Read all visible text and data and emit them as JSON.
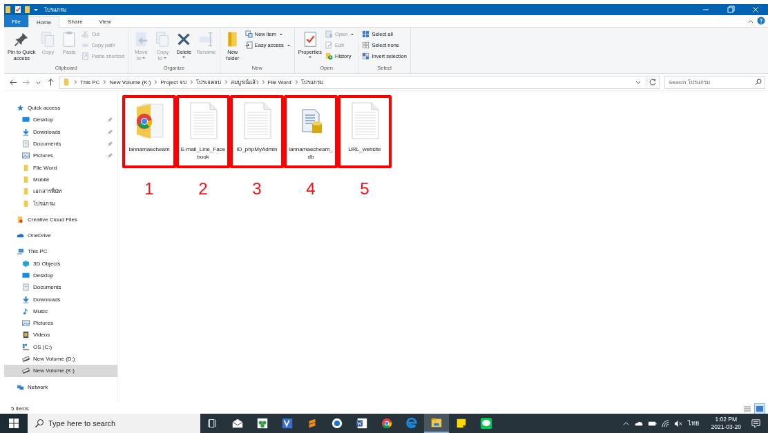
{
  "window": {
    "title": "โปรแกรม"
  },
  "ribbon_tabs": [
    {
      "label": "File",
      "kind": "file",
      "selected": false
    },
    {
      "label": "Home",
      "kind": "tab",
      "selected": true
    },
    {
      "label": "Share",
      "kind": "tab",
      "selected": false
    },
    {
      "label": "View",
      "kind": "tab",
      "selected": false
    }
  ],
  "ribbon_groups": [
    {
      "label": "Clipboard",
      "large": [
        {
          "kind": "pin",
          "lines": [
            "Pin to Quick",
            "access"
          ],
          "disabled": false,
          "dropdown": false
        },
        {
          "kind": "copy",
          "lines": [
            "Copy"
          ],
          "disabled": true,
          "dropdown": false
        },
        {
          "kind": "paste",
          "lines": [
            "Paste"
          ],
          "disabled": true,
          "dropdown": false
        }
      ],
      "small": [
        {
          "kind": "cut",
          "label": "Cut",
          "disabled": true,
          "dropdown": false
        },
        {
          "kind": "copy-path",
          "label": "Copy path",
          "disabled": true,
          "dropdown": false
        },
        {
          "kind": "paste-shortcut",
          "label": "Paste shortcut",
          "disabled": true,
          "dropdown": false
        }
      ]
    },
    {
      "label": "Organize",
      "large": [
        {
          "kind": "move",
          "lines": [
            "Move",
            "to"
          ],
          "disabled": true,
          "dropdown": true
        },
        {
          "kind": "copy-to",
          "lines": [
            "Copy",
            "to"
          ],
          "disabled": true,
          "dropdown": true
        },
        {
          "kind": "delete",
          "lines": [
            "Delete"
          ],
          "disabled": false,
          "dropdown": true
        },
        {
          "kind": "rename",
          "lines": [
            "Rename"
          ],
          "disabled": true,
          "dropdown": false
        }
      ]
    },
    {
      "label": "New",
      "large": [
        {
          "kind": "new-folder",
          "lines": [
            "New",
            "folder"
          ],
          "disabled": false,
          "dropdown": false
        }
      ],
      "small": [
        {
          "kind": "new-item",
          "label": "New item",
          "disabled": false,
          "dropdown": true
        },
        {
          "kind": "easy-access",
          "label": "Easy access",
          "disabled": false,
          "dropdown": true
        }
      ]
    },
    {
      "label": "Open",
      "large": [
        {
          "kind": "properties",
          "lines": [
            "Properties"
          ],
          "disabled": false,
          "dropdown": true
        }
      ],
      "small": [
        {
          "kind": "open",
          "label": "Open",
          "disabled": true,
          "dropdown": true
        },
        {
          "kind": "edit",
          "label": "Edit",
          "disabled": true,
          "dropdown": false
        },
        {
          "kind": "history",
          "label": "History",
          "disabled": false,
          "dropdown": false
        }
      ]
    },
    {
      "label": "Select",
      "small": [
        {
          "kind": "select-all",
          "label": "Select all",
          "disabled": false,
          "dropdown": false
        },
        {
          "kind": "select-none",
          "label": "Select none",
          "disabled": false,
          "dropdown": false
        },
        {
          "kind": "invert",
          "label": "Invert selection",
          "disabled": false,
          "dropdown": false
        }
      ]
    }
  ],
  "nav_buttons": [
    {
      "kind": "back",
      "disabled": false
    },
    {
      "kind": "forward",
      "disabled": true
    },
    {
      "kind": "recent",
      "disabled": false
    },
    {
      "kind": "up",
      "disabled": false
    }
  ],
  "breadcrumbs": [
    "This PC",
    "New Volume (K:)",
    "Project จบ",
    "โปรเจคจบ",
    "สมบูรณ์แล้ว",
    "File Word",
    "โปรแกรม"
  ],
  "search": {
    "placeholder": "Search โปรแกรม"
  },
  "sidebar": [
    {
      "label": "Quick access",
      "kind": "star",
      "selected": false,
      "children": [
        {
          "label": "Desktop",
          "kind": "desktop",
          "selected": false,
          "pinned": true
        },
        {
          "label": "Downloads",
          "kind": "download",
          "selected": false,
          "pinned": true
        },
        {
          "label": "Documents",
          "kind": "document",
          "selected": false,
          "pinned": true
        },
        {
          "label": "Pictures",
          "kind": "pictures",
          "selected": false,
          "pinned": true
        },
        {
          "label": "File Word",
          "kind": "folder",
          "selected": false,
          "pinned": false
        },
        {
          "label": "Mobile",
          "kind": "folder",
          "selected": false,
          "pinned": false
        },
        {
          "label": "เอกสารพี่นัท",
          "kind": "folder",
          "selected": false,
          "pinned": false
        },
        {
          "label": "โปรแกรม",
          "kind": "folder",
          "selected": false,
          "pinned": false
        }
      ]
    },
    {
      "label": "Creative Cloud Files",
      "kind": "cloud-folder",
      "selected": false
    },
    {
      "label": "OneDrive",
      "kind": "cloud",
      "selected": false
    },
    {
      "label": "This PC",
      "kind": "pc",
      "selected": false,
      "children": [
        {
          "label": "3D Objects",
          "kind": "cube",
          "selected": false,
          "pinned": false
        },
        {
          "label": "Desktop",
          "kind": "desktop",
          "selected": false,
          "pinned": false
        },
        {
          "label": "Documents",
          "kind": "document",
          "selected": false,
          "pinned": false
        },
        {
          "label": "Downloads",
          "kind": "download",
          "selected": false,
          "pinned": false
        },
        {
          "label": "Music",
          "kind": "music",
          "selected": false,
          "pinned": false
        },
        {
          "label": "Pictures",
          "kind": "pictures",
          "selected": false,
          "pinned": false
        },
        {
          "label": "Videos",
          "kind": "video",
          "selected": false,
          "pinned": false
        },
        {
          "label": "OS (C:)",
          "kind": "os-drive",
          "selected": false,
          "pinned": false
        },
        {
          "label": "New Volume (D:)",
          "kind": "drive",
          "selected": false,
          "pinned": false
        },
        {
          "label": "New Volume (K:)",
          "kind": "drive",
          "selected": true,
          "pinned": false
        }
      ]
    },
    {
      "label": "Network",
      "kind": "network",
      "selected": false
    }
  ],
  "files": [
    {
      "kind": "chrome-folder",
      "name_lines": [
        "lannamaecheam"
      ],
      "marker": "1",
      "annotated": true
    },
    {
      "kind": "text",
      "name_lines": [
        "E-mail_Line_Face",
        "book"
      ],
      "marker": "2",
      "annotated": true
    },
    {
      "kind": "text",
      "name_lines": [
        "ID_phpMyAdmin"
      ],
      "marker": "3",
      "annotated": true
    },
    {
      "kind": "database",
      "name_lines": [
        "lannamaecheam_",
        "db"
      ],
      "marker": "4",
      "annotated": true
    },
    {
      "kind": "text",
      "name_lines": [
        "URL_website"
      ],
      "marker": "5",
      "annotated": true
    }
  ],
  "status_bar": {
    "item_count": "5 items",
    "views": [
      {
        "kind": "details",
        "selected": false
      },
      {
        "kind": "large-icons",
        "selected": true
      }
    ]
  },
  "taskbar": {
    "search_placeholder": "Type here to search",
    "apps": [
      {
        "kind": "task-view",
        "active": false
      },
      {
        "kind": "mail",
        "active": false
      },
      {
        "kind": "green-app",
        "active": false
      },
      {
        "kind": "blue-app",
        "active": false
      },
      {
        "kind": "orange-app",
        "active": false
      },
      {
        "kind": "round-app",
        "active": false
      },
      {
        "kind": "word",
        "active": false
      },
      {
        "kind": "chrome",
        "active": false
      },
      {
        "kind": "edge",
        "active": false
      },
      {
        "kind": "explorer",
        "active": true
      },
      {
        "kind": "sticky",
        "active": false
      },
      {
        "kind": "chat",
        "active": false
      }
    ],
    "language": "ไทย",
    "time": "1:02 PM",
    "date": "2021-03-20"
  }
}
